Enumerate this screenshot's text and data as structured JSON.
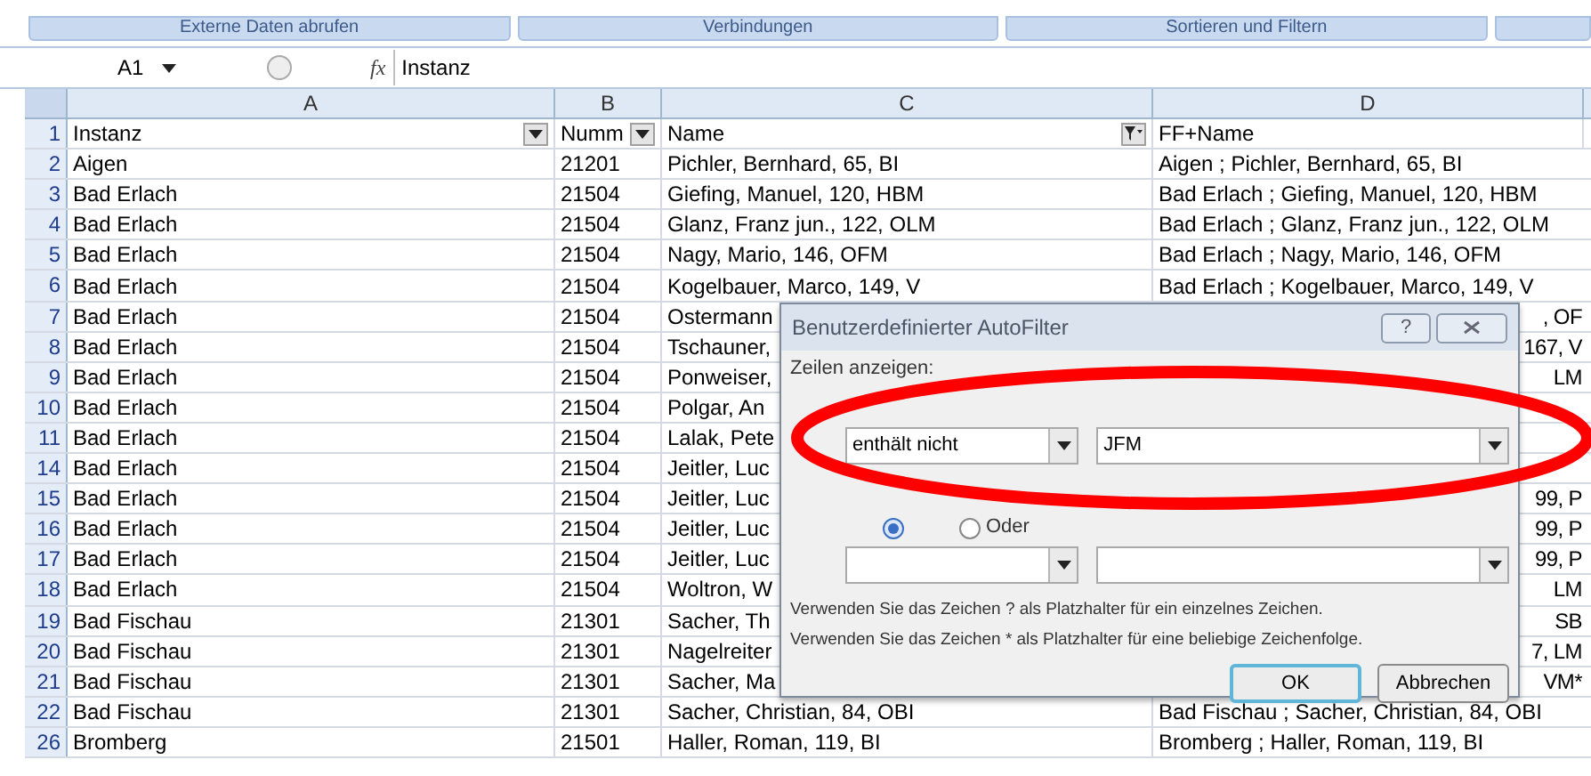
{
  "ribbon_groups": [
    "Externe Daten abrufen",
    "Verbindungen",
    "Sortieren und Filtern"
  ],
  "formula_bar": {
    "cell_ref": "A1",
    "function_label": "fx",
    "content": "Instanz"
  },
  "column_letters": [
    "A",
    "B",
    "C",
    "D"
  ],
  "header_row": {
    "num": "1",
    "cells": [
      {
        "text": "Instanz",
        "filtered": false
      },
      {
        "text": "Numm",
        "filtered": false
      },
      {
        "text": "Name",
        "filtered": true
      },
      {
        "text": "FF+Name"
      }
    ]
  },
  "rows": [
    {
      "num": "2",
      "cells": [
        "Aigen",
        "21201",
        "Pichler, Bernhard, 65, BI"
      ],
      "ff_name": {
        "text": "Aigen ; Pichler, Bernhard, 65, BI",
        "kind": "full"
      }
    },
    {
      "num": "3",
      "cells": [
        "Bad Erlach",
        "21504",
        "Giefing, Manuel, 120, HBM"
      ],
      "ff_name": {
        "text": "Bad Erlach ; Giefing, Manuel, 120, HBM",
        "kind": "full"
      }
    },
    {
      "num": "4",
      "cells": [
        "Bad Erlach",
        "21504",
        "Glanz, Franz jun., 122, OLM"
      ],
      "ff_name": {
        "text": "Bad Erlach ; Glanz, Franz jun., 122, OLM",
        "kind": "full"
      }
    },
    {
      "num": "5",
      "cells": [
        "Bad Erlach",
        "21504",
        "Nagy, Mario, 146, OFM"
      ],
      "ff_name": {
        "text": "Bad Erlach ; Nagy, Mario, 146, OFM",
        "kind": "full"
      }
    },
    {
      "num": "6",
      "cells": [
        "Bad Erlach",
        "21504",
        "Kogelbauer, Marco, 149, V"
      ],
      "ff_name": {
        "text": "Bad Erlach ; Kogelbauer, Marco, 149, V",
        "kind": "full"
      }
    },
    {
      "num": "7",
      "cells": [
        "Bad Erlach",
        "21504",
        "Ostermann"
      ],
      "ff_name": {
        "text": ", OF",
        "kind": "tail"
      }
    },
    {
      "num": "8",
      "cells": [
        "Bad Erlach",
        "21504",
        "Tschauner,"
      ],
      "ff_name": {
        "text": "167, V",
        "kind": "tail"
      }
    },
    {
      "num": "9",
      "cells": [
        "Bad Erlach",
        "21504",
        "Ponweiser,"
      ],
      "ff_name": {
        "text": "LM",
        "kind": "tail"
      }
    },
    {
      "num": "10",
      "cells": [
        "Bad Erlach",
        "21504",
        "Polgar, An"
      ]
    },
    {
      "num": "11",
      "cells": [
        "Bad Erlach",
        "21504",
        "Lalak, Pete"
      ]
    },
    {
      "num": "14",
      "cells": [
        "Bad Erlach",
        "21504",
        "Jeitler, Luc"
      ]
    },
    {
      "num": "15",
      "cells": [
        "Bad Erlach",
        "21504",
        "Jeitler, Luc"
      ],
      "ff_name": {
        "text": "99, P",
        "kind": "tail"
      }
    },
    {
      "num": "16",
      "cells": [
        "Bad Erlach",
        "21504",
        "Jeitler, Luc"
      ],
      "ff_name": {
        "text": "99, P",
        "kind": "tail"
      }
    },
    {
      "num": "17",
      "cells": [
        "Bad Erlach",
        "21504",
        "Jeitler, Luc"
      ],
      "ff_name": {
        "text": "99, P",
        "kind": "tail"
      }
    },
    {
      "num": "18",
      "cells": [
        "Bad Erlach",
        "21504",
        "Woltron, W"
      ],
      "ff_name": {
        "text": "LM",
        "kind": "tail"
      }
    },
    {
      "num": "19",
      "cells": [
        "Bad Fischau",
        "21301",
        "Sacher, Th"
      ],
      "ff_name": {
        "text": "SB",
        "kind": "tail"
      }
    },
    {
      "num": "20",
      "cells": [
        "Bad Fischau",
        "21301",
        "Nagelreiter"
      ],
      "ff_name": {
        "text": "7, LM",
        "kind": "tail"
      }
    },
    {
      "num": "21",
      "cells": [
        "Bad Fischau",
        "21301",
        "Sacher, Ma"
      ],
      "ff_name": {
        "text": "VM*",
        "kind": "tail"
      }
    },
    {
      "num": "22",
      "cells": [
        "Bad Fischau",
        "21301",
        "Sacher, Christian, 84, OBI"
      ],
      "ff_name": {
        "text": "Bad Fischau ; Sacher, Christian, 84, OBI",
        "kind": "full"
      }
    },
    {
      "num": "26",
      "cells": [
        "Bromberg",
        "21501",
        "Haller, Roman, 119, BI"
      ],
      "ff_name": {
        "text": "Bromberg ; Haller, Roman, 119, BI",
        "kind": "full"
      }
    }
  ],
  "dialog": {
    "title": "Benutzerdefinierter AutoFilter",
    "help": "?",
    "section_label": "Zeilen anzeigen:",
    "conditions": [
      {
        "operator": "enthält nicht",
        "value": "JFM"
      }
    ],
    "joins": [
      {
        "selected": true
      },
      {
        "label": "Oder",
        "selected": false
      }
    ],
    "hints": [
      "Verwenden Sie das Zeichen ? als Platzhalter für ein einzelnes Zeichen.",
      "Verwenden Sie das Zeichen * als Platzhalter für eine beliebige Zeichenfolge."
    ],
    "buttons": [
      {
        "label": "OK",
        "default": true
      },
      {
        "label": "Abbrechen",
        "default": false
      }
    ]
  }
}
